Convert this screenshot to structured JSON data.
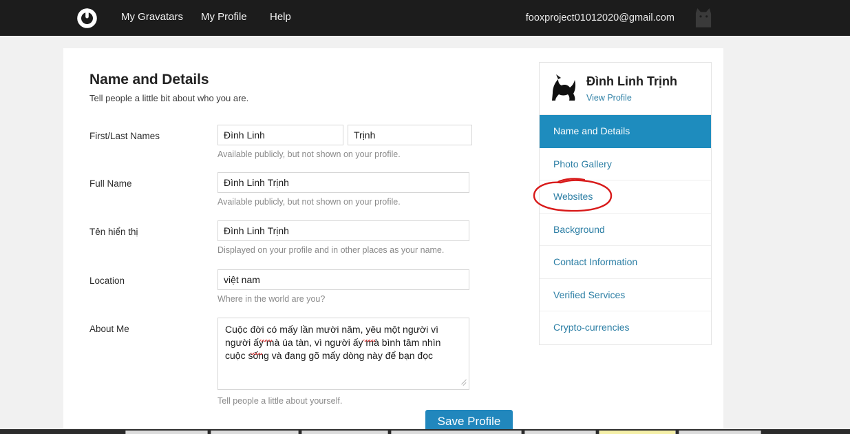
{
  "topbar": {
    "logo_icon": "gravatar-logo-icon",
    "nav": [
      {
        "label": "My Gravatars"
      },
      {
        "label": "My Profile"
      },
      {
        "label": "Help"
      }
    ],
    "account_email": "fooxproject01012020@gmail.com",
    "avatar_icon": "cat-avatar-icon"
  },
  "main": {
    "title": "Name and Details",
    "subtitle": "Tell people a little bit about who you are.",
    "fields": {
      "names": {
        "label": "First/Last Names",
        "first_value": "Đình Linh",
        "last_value": "Trịnh",
        "hint": "Available publicly, but not shown on your profile."
      },
      "full_name": {
        "label": "Full Name",
        "value": "Đình Linh Trịnh",
        "hint": "Available publicly, but not shown on your profile."
      },
      "display_name": {
        "label": "Tên hiển thị",
        "value": "Đình Linh Trịnh",
        "hint": "Displayed on your profile and in other places as your name."
      },
      "location": {
        "label": "Location",
        "value": "việt nam",
        "hint": "Where in the world are you?"
      },
      "about_me": {
        "label": "About Me",
        "value": "Cuộc đời có mấy lần mười năm, yêu một người vì người ấy mà úa tàn, vì người ấy mà bình tâm nhìn cuộc sống và đang gõ mấy dòng này để bạn đọc",
        "hint": "Tell people a little about yourself."
      }
    },
    "save_button": "Save Profile"
  },
  "sidebar": {
    "profile_name": "Đình Linh Trịnh",
    "view_profile_label": "View Profile",
    "avatar_icon": "cat-avatar-icon",
    "items": [
      {
        "label": "Name and Details",
        "active": true
      },
      {
        "label": "Photo Gallery",
        "active": false
      },
      {
        "label": "Websites",
        "active": false
      },
      {
        "label": "Background",
        "active": false
      },
      {
        "label": "Contact Information",
        "active": false
      },
      {
        "label": "Verified Services",
        "active": false
      },
      {
        "label": "Crypto-currencies",
        "active": false
      }
    ]
  },
  "annotation": {
    "shape": "hand-drawn-red-ellipse",
    "targets": "Websites",
    "color": "#d81a1a"
  },
  "colors": {
    "topbar_bg": "#1c1c1c",
    "page_bg": "#f1f1f1",
    "card_bg": "#ffffff",
    "accent_blue": "#1e8cbe",
    "link_blue": "#2d7fa5",
    "button_blue": "#2187bd",
    "annotation_red": "#d81a1a"
  }
}
